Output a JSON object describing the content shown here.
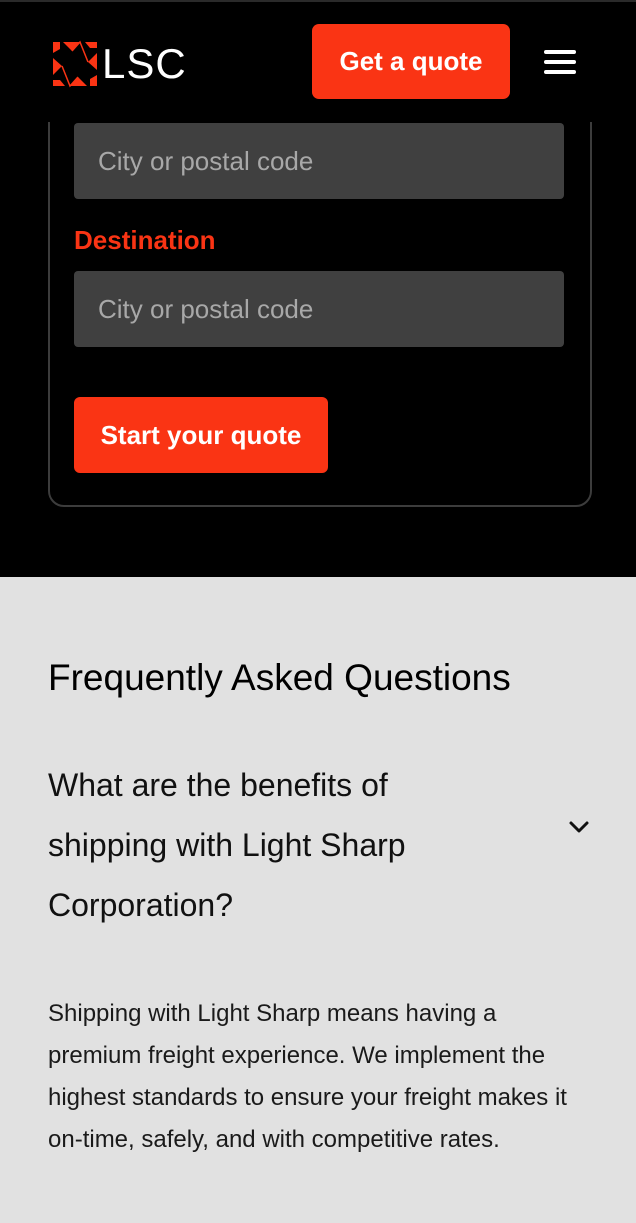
{
  "header": {
    "logo_text": "LSC",
    "logo_icon": "lsc-star-mark-icon",
    "cta_label": "Get a quote",
    "menu_icon": "hamburger-menu-icon"
  },
  "quote_form": {
    "origin_placeholder": "City or postal code",
    "destination_label": "Destination",
    "destination_placeholder": "City or postal code",
    "submit_label": "Start your quote"
  },
  "faq": {
    "heading": "Frequently Asked Questions",
    "items": [
      {
        "question": "What are the benefits of shipping with Light Sharp Corporation?",
        "toggle_icon": "chevron-down-icon",
        "answer": "Shipping with Light Sharp means having a premium freight experience. We implement the highest standards to ensure your freight makes it on-time, safely, and with competitive rates."
      }
    ]
  },
  "colors": {
    "accent": "#fa3414",
    "dark_bg": "#000000",
    "input_bg": "#404040",
    "light_bg": "#e1e1e1"
  }
}
